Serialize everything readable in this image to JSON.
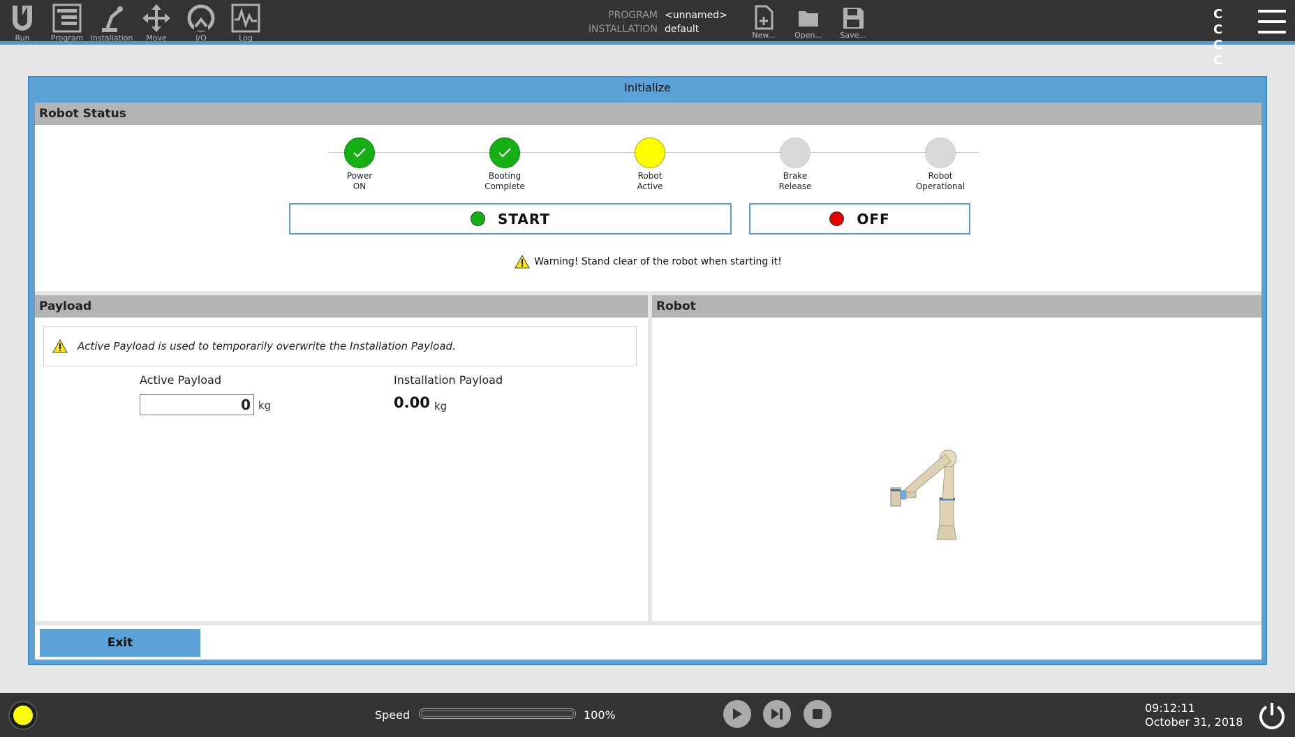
{
  "nav": {
    "items": [
      {
        "label": "Run",
        "icon": "ur-logo-icon"
      },
      {
        "label": "Program",
        "icon": "program-icon"
      },
      {
        "label": "Installation",
        "icon": "installation-icon"
      },
      {
        "label": "Move",
        "icon": "move-icon"
      },
      {
        "label": "I/O",
        "icon": "io-icon"
      },
      {
        "label": "Log",
        "icon": "log-icon"
      }
    ]
  },
  "program_info": {
    "program_key": "PROGRAM",
    "program_value": "<unnamed>",
    "installation_key": "INSTALLATION",
    "installation_value": "default"
  },
  "file_actions": {
    "new_label": "New...",
    "open_label": "Open...",
    "save_label": "Save..."
  },
  "top_right": {
    "cc_text": "C C C C"
  },
  "dialog": {
    "title": "Initialize",
    "robot_status": {
      "header": "Robot Status",
      "steps": [
        {
          "line1": "Power",
          "line2": "ON",
          "state": "done"
        },
        {
          "line1": "Booting",
          "line2": "Complete",
          "state": "done"
        },
        {
          "line1": "Robot",
          "line2": "Active",
          "state": "active"
        },
        {
          "line1": "Brake",
          "line2": "Release",
          "state": "pending"
        },
        {
          "line1": "Robot",
          "line2": "Operational",
          "state": "pending"
        }
      ],
      "start_label": "START",
      "off_label": "OFF",
      "warning": "Warning! Stand clear of the robot when starting it!"
    },
    "payload": {
      "header": "Payload",
      "note": "Active Payload is used to temporarily overwrite the Installation Payload.",
      "active_label": "Active Payload",
      "active_value": "0",
      "active_unit": "kg",
      "installation_label": "Installation Payload",
      "installation_value": "0.00",
      "installation_unit": "kg"
    },
    "robot": {
      "header": "Robot"
    },
    "exit_label": "Exit"
  },
  "bottom": {
    "speed_label": "Speed",
    "speed_value": "100%",
    "speed_fraction": 1.0,
    "time": "09:12:11",
    "date": "October 31, 2018"
  },
  "colors": {
    "accent": "#5aa2d8",
    "status_green": "#14b014",
    "status_yellow": "#ffff00",
    "status_red": "#e00000",
    "topbar": "#333333"
  }
}
